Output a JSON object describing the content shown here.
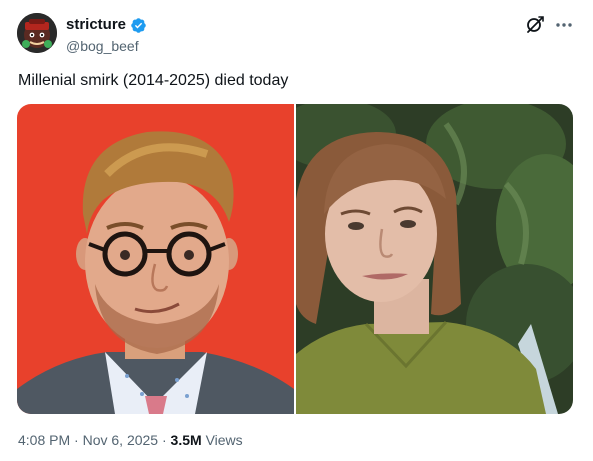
{
  "post": {
    "author_name": "stricture",
    "author_handle": "@bog_beef",
    "text": "Millenial smirk (2014-2025) died today",
    "time": "4:08 PM",
    "separator": "·",
    "date": "Nov 6, 2025",
    "views_count": "3.5M",
    "views_label": "Views"
  },
  "media": {
    "images": [
      {
        "subject": "man-with-quiff-and-round-glasses-smirking",
        "background": "#e8412c"
      },
      {
        "subject": "woman-in-olive-shirt-smirking",
        "background": "#2d3d26"
      }
    ]
  },
  "icons": {
    "verified": "verified-badge-icon",
    "grok": "grok-icon",
    "more": "more-options-icon"
  },
  "colors": {
    "text_primary": "#0f1419",
    "text_secondary": "#536471",
    "verified_blue": "#1d9bf0"
  }
}
